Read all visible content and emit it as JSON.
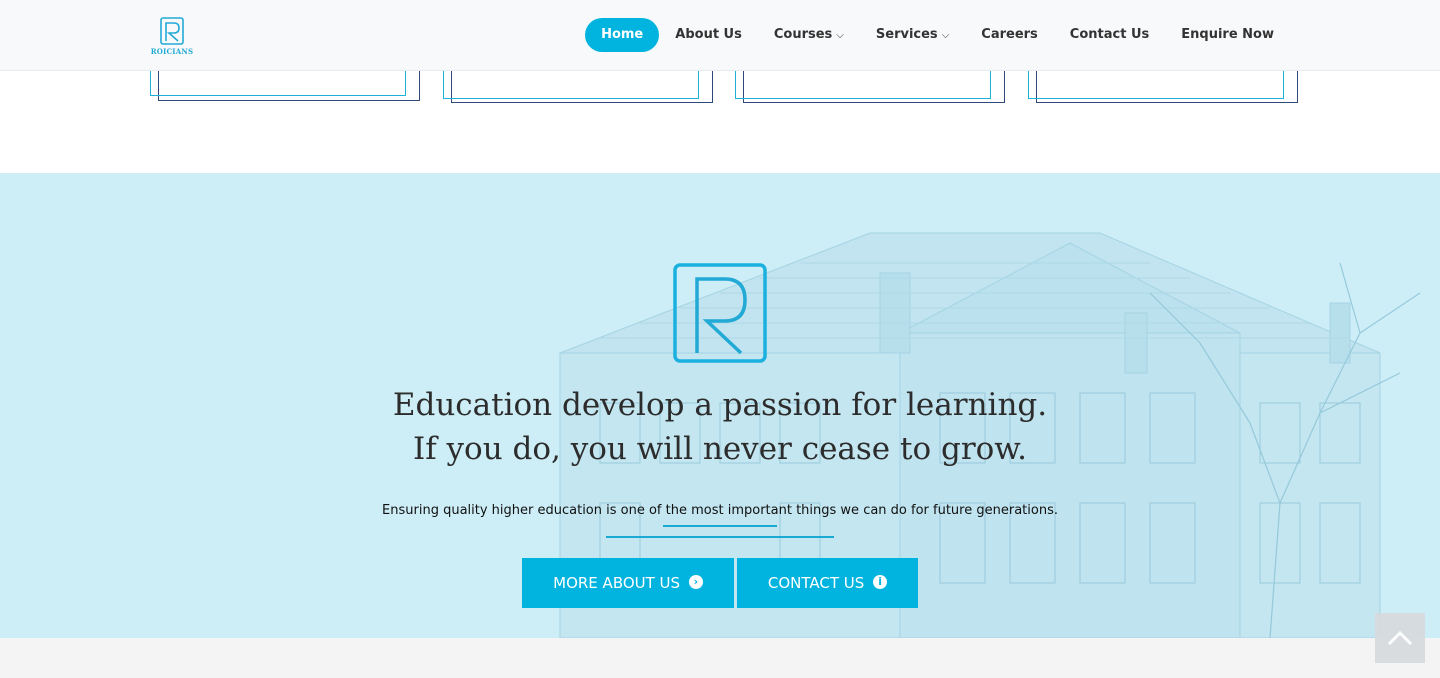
{
  "brand": {
    "name": "ROICIANS"
  },
  "nav": {
    "items": [
      {
        "label": "Home",
        "active": true,
        "dropdown": false
      },
      {
        "label": "About Us",
        "active": false,
        "dropdown": false
      },
      {
        "label": "Courses",
        "active": false,
        "dropdown": true
      },
      {
        "label": "Services",
        "active": false,
        "dropdown": true
      },
      {
        "label": "Careers",
        "active": false,
        "dropdown": false
      },
      {
        "label": "Contact Us",
        "active": false,
        "dropdown": false
      },
      {
        "label": "Enquire Now",
        "active": false,
        "dropdown": false
      }
    ]
  },
  "hero": {
    "headline_line1": "Education develop a passion for learning.",
    "headline_line2": "If you do, you will never cease to grow.",
    "subtitle": "Ensuring quality higher education is one of the most important things we can do for future generations.",
    "more_label": "MORE ABOUT US",
    "more_icon": "arrow-circle-right-icon",
    "contact_label": "CONTACT US",
    "contact_icon": "info-circle-icon"
  },
  "colors": {
    "accent": "#00b4df",
    "hero_background": "#cdeef7",
    "header_background": "#f8f9fa",
    "text_dark": "#2c2c2c"
  },
  "icons": {
    "back_to_top": "chevron-up-icon"
  }
}
